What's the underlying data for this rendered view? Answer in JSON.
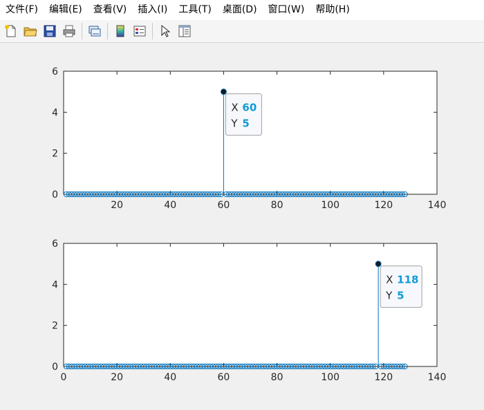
{
  "menu": [
    {
      "label": "文件(F)"
    },
    {
      "label": "编辑(E)"
    },
    {
      "label": "查看(V)"
    },
    {
      "label": "插入(I)"
    },
    {
      "label": "工具(T)"
    },
    {
      "label": "桌面(D)"
    },
    {
      "label": "窗口(W)"
    },
    {
      "label": "帮助(H)"
    }
  ],
  "toolbar": {
    "icons": [
      "new-figure-icon",
      "open-file-icon",
      "save-icon",
      "print-icon",
      "link-plot-icon",
      "insert-colorbar-icon",
      "insert-legend-icon",
      "select-pointer-icon",
      "property-inspector-icon"
    ]
  },
  "colors": {
    "stem": "#0072bd",
    "datatip_value": "#0e9bd8"
  },
  "chart_data": [
    {
      "type": "stem",
      "x_range": [
        1,
        128
      ],
      "baseline_value": 0,
      "impulses": [
        {
          "x": 60,
          "y": 5
        }
      ],
      "xlim": [
        0,
        140
      ],
      "ylim": [
        0,
        6
      ],
      "xticks": [
        "20",
        "40",
        "60",
        "80",
        "100",
        "120",
        "140"
      ],
      "yticks": [
        "0",
        "2",
        "4",
        "6"
      ],
      "datatip": {
        "x_label": "X",
        "x_value": "60",
        "y_label": "Y",
        "y_value": "5"
      }
    },
    {
      "type": "stem",
      "x_range": [
        1,
        128
      ],
      "baseline_value": 0,
      "impulses": [
        {
          "x": 118,
          "y": 5
        }
      ],
      "xlim": [
        0,
        140
      ],
      "ylim": [
        0,
        6
      ],
      "xticks": [
        "0",
        "20",
        "40",
        "60",
        "80",
        "100",
        "120",
        "140"
      ],
      "yticks": [
        "0",
        "2",
        "4",
        "6"
      ],
      "datatip": {
        "x_label": "X",
        "x_value": "118",
        "y_label": "Y",
        "y_value": "5"
      }
    }
  ]
}
